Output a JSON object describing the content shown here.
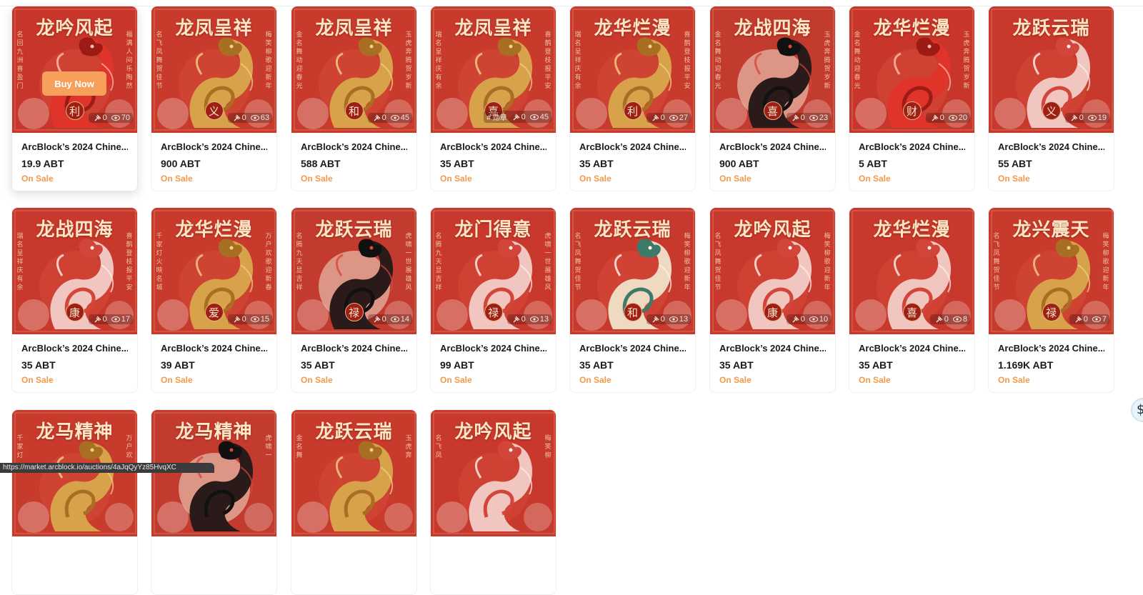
{
  "buy_button_label": "Buy Now",
  "status_url": "https://market.arcblock.io/auctions/4aJqQyYz85HvqXC",
  "cards": [
    {
      "name": "ArcBlock’s 2024 Chine...",
      "price": "19.9 ABT",
      "status": "On Sale",
      "likes": "0",
      "views": "70",
      "art_title": "龙吟风起",
      "left_poem": "名回九洲喜盈门",
      "right_poem": "福满人间乐陶然",
      "seal": "利",
      "style": "red",
      "tag": ""
    },
    {
      "name": "ArcBlock’s 2024 Chine...",
      "price": "900 ABT",
      "status": "On Sale",
      "likes": "0",
      "views": "63",
      "art_title": "龙凤呈祥",
      "left_poem": "名飞凤舞贺佳节",
      "right_poem": "梅笑柳歌迎新年",
      "seal": "义",
      "style": "gold",
      "tag": ""
    },
    {
      "name": "ArcBlock’s 2024 Chine...",
      "price": "588 ABT",
      "status": "On Sale",
      "likes": "0",
      "views": "45",
      "art_title": "龙凤呈祥",
      "left_poem": "金名舞动迎春光",
      "right_poem": "玉虎奔腾贺岁新",
      "seal": "和",
      "style": "gold",
      "tag": ""
    },
    {
      "name": "ArcBlock’s 2024 Chine...",
      "price": "35 ABT",
      "status": "On Sale",
      "likes": "0",
      "views": "45",
      "art_title": "龙凤呈祥",
      "left_poem": "瑞名呈祥庆有余",
      "right_poem": "喜鹊登枝报平安",
      "seal": "喜",
      "style": "gold",
      "tag": "# 勋章"
    },
    {
      "name": "ArcBlock’s 2024 Chine...",
      "price": "35 ABT",
      "status": "On Sale",
      "likes": "0",
      "views": "27",
      "art_title": "龙华烂漫",
      "left_poem": "瑞名呈祥庆有余",
      "right_poem": "喜鹊登枝报平安",
      "seal": "利",
      "style": "gold",
      "tag": ""
    },
    {
      "name": "ArcBlock’s 2024 Chine...",
      "price": "900 ABT",
      "status": "On Sale",
      "likes": "0",
      "views": "23",
      "art_title": "龙战四海",
      "left_poem": "金名舞动迎春光",
      "right_poem": "玉虎奔腾贺岁新",
      "seal": "喜",
      "style": "black",
      "tag": ""
    },
    {
      "name": "ArcBlock’s 2024 Chine...",
      "price": "5 ABT",
      "status": "On Sale",
      "likes": "0",
      "views": "20",
      "art_title": "龙华烂漫",
      "left_poem": "金名舞动迎春光",
      "right_poem": "玉虎奔腾贺岁新",
      "seal": "财",
      "style": "red",
      "tag": ""
    },
    {
      "name": "ArcBlock’s 2024 Chine...",
      "price": "55 ABT",
      "status": "On Sale",
      "likes": "0",
      "views": "19",
      "art_title": "龙跃云瑞",
      "left_poem": "",
      "right_poem": "",
      "seal": "义",
      "style": "pink",
      "tag": ""
    },
    {
      "name": "ArcBlock’s 2024 Chine...",
      "price": "35 ABT",
      "status": "On Sale",
      "likes": "0",
      "views": "17",
      "art_title": "龙战四海",
      "left_poem": "瑞名呈祥庆有余",
      "right_poem": "喜鹊登枝报平安",
      "seal": "康",
      "style": "pink",
      "tag": ""
    },
    {
      "name": "ArcBlock’s 2024 Chine...",
      "price": "39 ABT",
      "status": "On Sale",
      "likes": "0",
      "views": "15",
      "art_title": "龙华烂漫",
      "left_poem": "千家灯火映名城",
      "right_poem": "万户欢歌迎新春",
      "seal": "爱",
      "style": "gold",
      "tag": ""
    },
    {
      "name": "ArcBlock’s 2024 Chine...",
      "price": "35 ABT",
      "status": "On Sale",
      "likes": "0",
      "views": "14",
      "art_title": "龙跃云瑞",
      "left_poem": "名腾九天显吉祥",
      "right_poem": "虎啸一世展雄风",
      "seal": "禄",
      "style": "black",
      "tag": ""
    },
    {
      "name": "ArcBlock’s 2024 Chine...",
      "price": "99 ABT",
      "status": "On Sale",
      "likes": "0",
      "views": "13",
      "art_title": "龙门得意",
      "left_poem": "名腾九天显吉祥",
      "right_poem": "虎啸一世展雄风",
      "seal": "禄",
      "style": "pink",
      "tag": ""
    },
    {
      "name": "ArcBlock’s 2024 Chine...",
      "price": "35 ABT",
      "status": "On Sale",
      "likes": "0",
      "views": "13",
      "art_title": "龙跃云瑞",
      "left_poem": "名飞凤舞贺佳节",
      "right_poem": "梅笑柳歌迎新年",
      "seal": "和",
      "style": "cream",
      "tag": ""
    },
    {
      "name": "ArcBlock’s 2024 Chine...",
      "price": "35 ABT",
      "status": "On Sale",
      "likes": "0",
      "views": "10",
      "art_title": "龙吟风起",
      "left_poem": "名飞凤舞贺佳节",
      "right_poem": "梅笑柳歌迎新年",
      "seal": "康",
      "style": "pink",
      "tag": ""
    },
    {
      "name": "ArcBlock’s 2024 Chine...",
      "price": "35 ABT",
      "status": "On Sale",
      "likes": "0",
      "views": "8",
      "art_title": "龙华烂漫",
      "left_poem": "",
      "right_poem": "",
      "seal": "喜",
      "style": "pink",
      "tag": ""
    },
    {
      "name": "ArcBlock’s 2024 Chine...",
      "price": "1.169K ABT",
      "status": "On Sale",
      "likes": "0",
      "views": "7",
      "art_title": "龙兴震天",
      "left_poem": "名飞凤舞贺佳节",
      "right_poem": "梅笑柳歌迎新年",
      "seal": "禄",
      "style": "gold",
      "tag": ""
    },
    {
      "name": "",
      "price": "",
      "status": "",
      "likes": "",
      "views": "",
      "art_title": "龙马精神",
      "left_poem": "千家灯",
      "right_poem": "万户欢",
      "seal": "",
      "style": "gold",
      "tag": ""
    },
    {
      "name": "",
      "price": "",
      "status": "",
      "likes": "",
      "views": "",
      "art_title": "龙马精神",
      "left_poem": "",
      "right_poem": "虎啸一",
      "seal": "",
      "style": "black",
      "tag": ""
    },
    {
      "name": "",
      "price": "",
      "status": "",
      "likes": "",
      "views": "",
      "art_title": "龙跃云瑞",
      "left_poem": "金名舞",
      "right_poem": "玉虎奔",
      "seal": "",
      "style": "gold",
      "tag": ""
    },
    {
      "name": "",
      "price": "",
      "status": "",
      "likes": "",
      "views": "",
      "art_title": "龙吟风起",
      "left_poem": "名飞凤",
      "right_poem": "梅笑柳",
      "seal": "",
      "style": "pink",
      "tag": ""
    }
  ],
  "colors": {
    "accent": "#f2994a",
    "buy_button": "#f6a05c",
    "card_red": "#c8352a",
    "gold": "#d4a24c"
  },
  "icons": {
    "like": "hammer-icon",
    "view": "eye-icon",
    "widget": "dollar-icon"
  }
}
